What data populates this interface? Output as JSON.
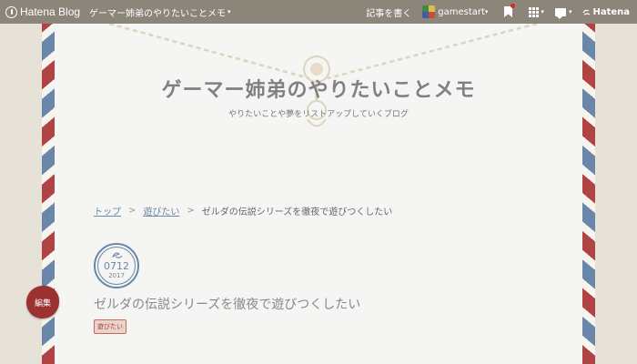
{
  "topbar": {
    "logo_text": "Hatena Blog",
    "blog_title": "ゲーマー姉弟のやりたいことメモ",
    "write_label": "記事を書く",
    "username": "gamestart",
    "hatena_label": "Hatena",
    "caret": "▾",
    "icons": [
      "hatena-blog-logo-icon",
      "bookmark-icon",
      "apps-grid-icon",
      "message-icon",
      "hatena-logo-icon"
    ],
    "notification_color": "#e02424"
  },
  "header": {
    "title": "ゲーマー姉弟のやりたいことメモ",
    "subtitle": "やりたいことや夢をリストアップしていくブログ"
  },
  "breadcrumb": {
    "items": [
      "トップ",
      "遊びたい",
      "ゼルダの伝説シリーズを徹夜で遊びつくしたい"
    ],
    "separator": ">"
  },
  "entry": {
    "date_md": "0712",
    "date_year": "2017",
    "title": "ゼルダの伝説シリーズを徹夜で遊びつくしたい",
    "category": "遊びたい"
  },
  "edit_button": {
    "label": "編集"
  },
  "colors": {
    "topbar": "#8b857a",
    "accent_blue": "#6a86a8",
    "accent_red": "#b04444",
    "page": "#f5f5f4",
    "background": "#e6e2d8"
  }
}
